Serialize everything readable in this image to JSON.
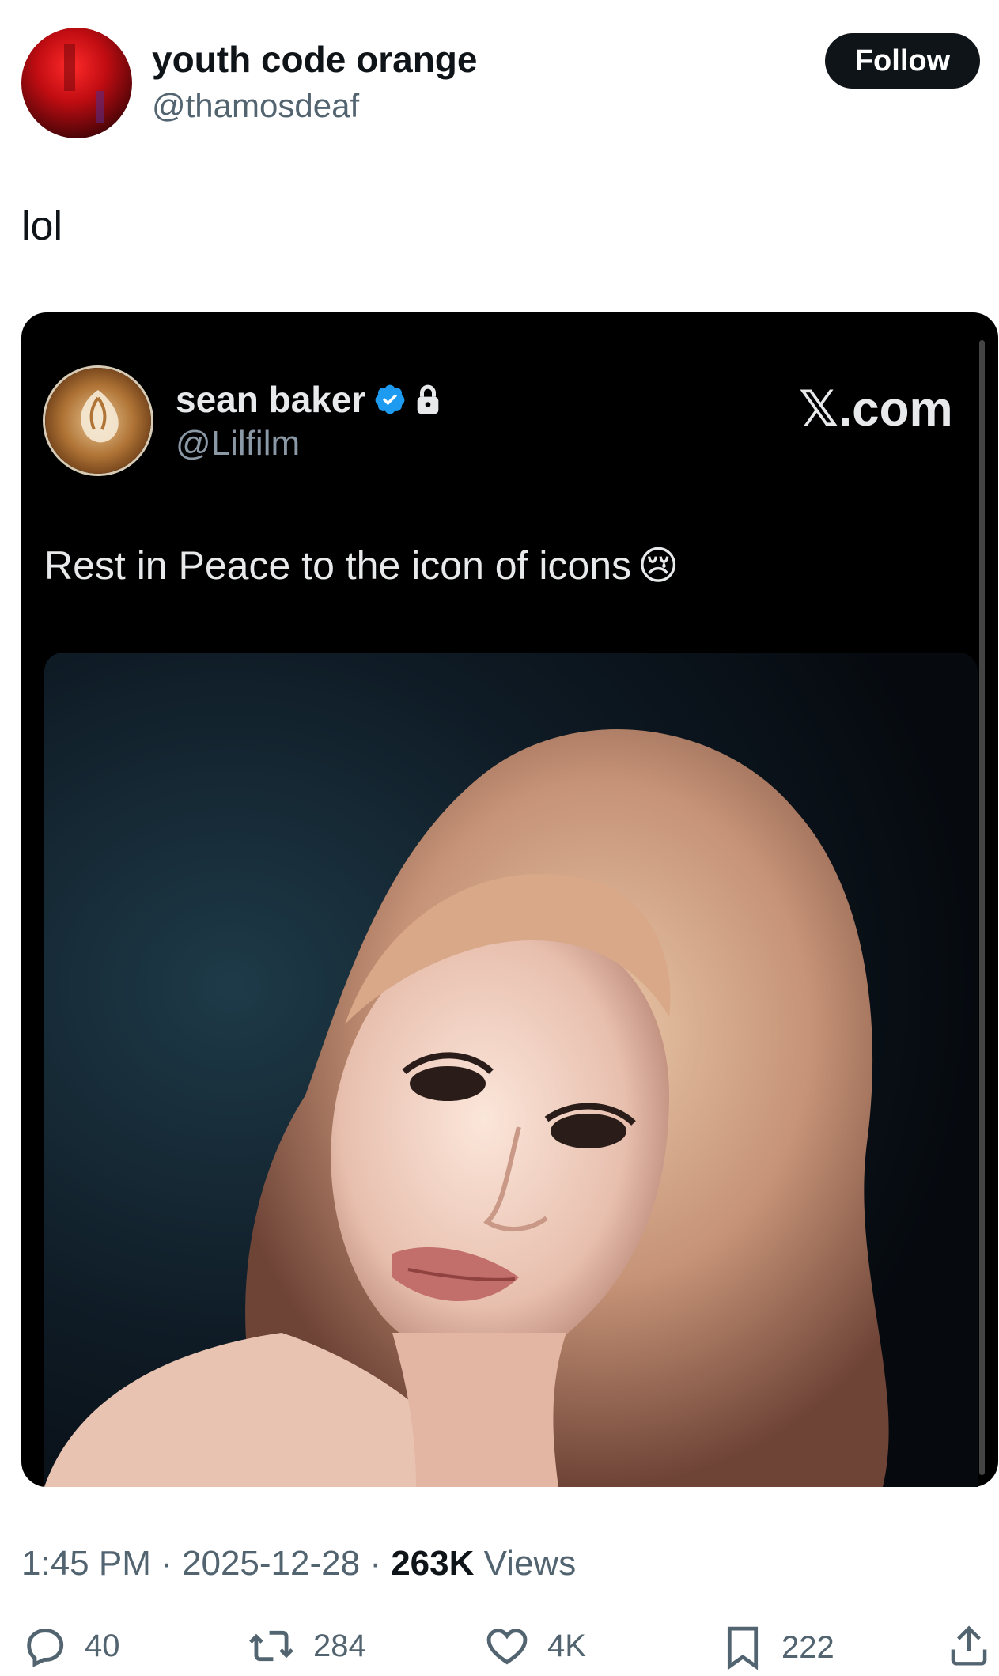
{
  "tweet": {
    "author_name": "youth code orange",
    "author_handle": "@thamosdeaf",
    "follow_label": "Follow",
    "text": "lol"
  },
  "quoted": {
    "author_name": "sean baker",
    "author_handle": "@Lilfilm",
    "source_label": "𝕏.com",
    "text": "Rest in Peace to the icon of icons",
    "emoji": "😢",
    "verified_color": "#1d9bf0"
  },
  "meta": {
    "time": "1:45 PM",
    "separator": "·",
    "date": "2025-12-28",
    "views_count": "263K",
    "views_label": "Views"
  },
  "actions": {
    "replies": "40",
    "reposts": "284",
    "likes": "4K",
    "bookmarks": "222"
  },
  "icons": {
    "reply": "reply-icon",
    "repost": "repost-icon",
    "like": "heart-icon",
    "bookmark": "bookmark-icon",
    "share": "share-icon",
    "verified": "verified-badge-icon",
    "lock": "lock-icon"
  }
}
